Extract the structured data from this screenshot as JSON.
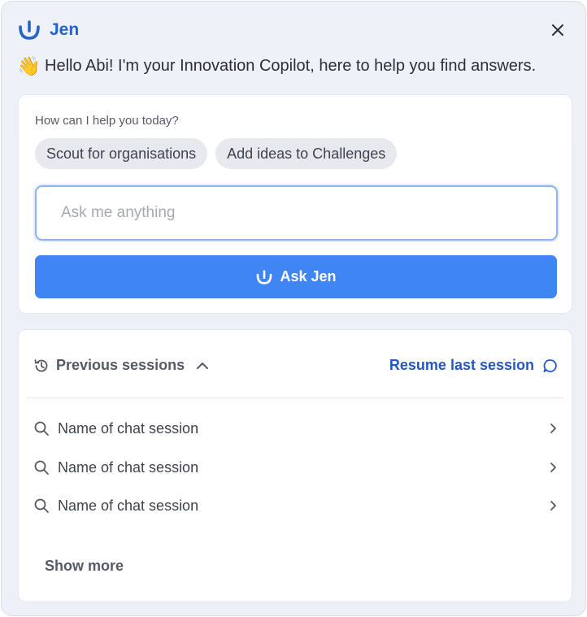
{
  "header": {
    "brand_name": "Jen",
    "brand_icon": "jen-smile-logo-icon",
    "close_icon": "close-icon"
  },
  "greeting": {
    "emoji": "👋",
    "text": "Hello Abi!  I'm your Innovation Copilot, here to help you find answers."
  },
  "help": {
    "prompt": "How can I help you today?",
    "chips": [
      "Scout for organisations",
      "Add ideas to Challenges"
    ],
    "input_value": "",
    "input_placeholder": "Ask me anything",
    "ask_button_label": "Ask Jen"
  },
  "sessions": {
    "toggle_label": "Previous sessions",
    "resume_label": "Resume last session",
    "items": [
      {
        "label": "Name of chat session"
      },
      {
        "label": "Name of chat session"
      },
      {
        "label": "Name of chat session"
      }
    ],
    "show_more_label": "Show more"
  },
  "colors": {
    "accent": "#3f86f4",
    "brand": "#2563c9",
    "link": "#2457c5"
  }
}
